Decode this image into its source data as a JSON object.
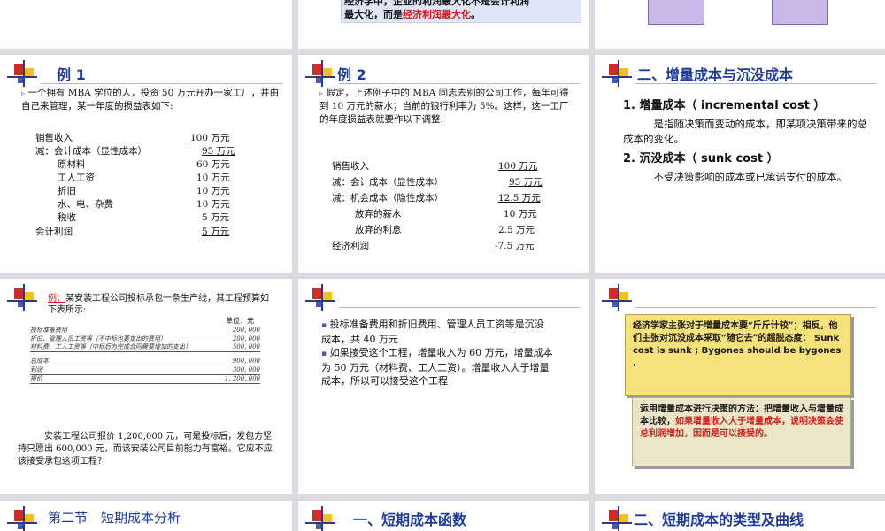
{
  "slide_top_middle": {
    "line1": "经济学中，企业的利润最大化不是会计利润",
    "line2_prefix": "最大化，而是",
    "line2_red": "经济利润最大化",
    "line2_suffix": "。"
  },
  "slide_example1": {
    "title": "例 1",
    "intro": "一个拥有 MBA 学位的人，投资 50 万元开办一家工厂，并由自己来管理，某一年度的损益表如下:",
    "rows": [
      {
        "label": "销售收入",
        "value": "100 万元"
      },
      {
        "label": "减：会计成本（显性成本）",
        "value": "95 万元"
      },
      {
        "label": "原材料",
        "value": "60 万元"
      },
      {
        "label": "工人工资",
        "value": "10 万元"
      },
      {
        "label": "折旧",
        "value": "10 万元"
      },
      {
        "label": "水、电、杂费",
        "value": "10 万元"
      },
      {
        "label": "税收",
        "value": "5 万元"
      },
      {
        "label": "会计利润",
        "value": "5 万元"
      }
    ]
  },
  "slide_example2": {
    "title": "例 2",
    "intro": "假定，上述例子中的 MBA 同志去别的公司工作，每年可得到 10 万元的薪水；当前的银行利率为 5%。这样，这一工厂的年度损益表就要作以下调整:",
    "rows": [
      {
        "label": "销售收入",
        "value": "100 万元"
      },
      {
        "label": "减：会计成本（显性成本）",
        "value": "95 万元"
      },
      {
        "label": "减：机会成本（隐性成本）",
        "value": "12.5 万元"
      },
      {
        "label": "放弃的薪水",
        "value": "10 万元"
      },
      {
        "label": "放弃的利息",
        "value": "2.5 万元"
      },
      {
        "label": "经济利润",
        "value": "-7.5 万元"
      }
    ]
  },
  "slide_incremental": {
    "title": "二、增量成本与沉没成本",
    "item1_head": "1. 增量成本（ incremental cost ）",
    "item1_body": "是指随决策而变动的成本，即某项决策带来的总成本的变化。",
    "item2_head": "2. 沉没成本（ sunk cost ）",
    "item2_body": "不受决策影响的成本或已承诺支付的成本。"
  },
  "slide_case": {
    "example_label": "例：",
    "intro": "某安装工程公司投标承包一条生产线，其工程预算如下表所示:",
    "unit": "单位：元",
    "rows": [
      {
        "label": "投标准备费用",
        "value": "200, 000"
      },
      {
        "label": "折旧、管理人员工资等（不中标也要支出的费用）",
        "value": "200, 000"
      },
      {
        "label": "材料费、工人工资等（中标后为完成合同需要增加的支出）",
        "value": "500, 000"
      },
      {
        "label": "总成本",
        "value": "900, 000"
      },
      {
        "label": "利润",
        "value": "300, 000"
      },
      {
        "label": "报价",
        "value": "1, 200, 000"
      }
    ],
    "question": "安装工程公司报价 1,200,000 元，可是投标后，发包方坚持只愿出 600,000 元，而该安装公司目前能力有富裕。它应不应该接受承包这项工程？"
  },
  "slide_analysis": {
    "bullet1": "投标准备费用和折旧费用、管理人员工资等是沉没成本，共 40 万元",
    "bullet2": "如果接受这个工程，增量收入为 60 万元，增量成本为 50 万元（材料费、工人工资）。增量收入大于增量成本，所以可以接受这个工程"
  },
  "slide_advice": {
    "box1_text": "经济学家主张对于增量成本要“斤斤计较”；相反，他们主张对沉没成本采取“随它去”的超脱态度：",
    "box1_en": "Sunk cost is sunk ; Bygones should be bygones .",
    "box2_prefix": "运用增量成本进行决策的方法：把增量收入与增量成本比较，",
    "box2_red": "如果增量收入大于增量成本，说明决策会使总利润增加，因而是可以接受的。"
  },
  "slide_bottom": {
    "left_title": "第二节　短期成本分析",
    "middle_title": "一、短期成本函数",
    "right_title": "二、短期成本的类型及曲线"
  },
  "colors": {
    "accent_blue": "#1f3a9a",
    "highlight_red": "#d21b1b",
    "box_yellow": "#f5e27a",
    "box_beige": "#ece6c9"
  }
}
